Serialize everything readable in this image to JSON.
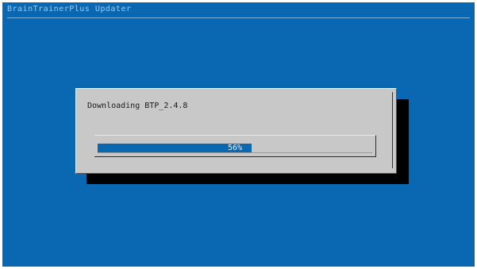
{
  "window": {
    "backtitle": "BrainTrainerPlus Updater"
  },
  "dialog": {
    "message": "Downloading BTP_2.4.8"
  },
  "progress": {
    "percent": 56,
    "label": "56%"
  },
  "colors": {
    "screen_bg": "#0a68b2",
    "dialog_bg": "#c8c8c8",
    "shadow": "#000000",
    "gauge_fill": "#0a68b2"
  }
}
